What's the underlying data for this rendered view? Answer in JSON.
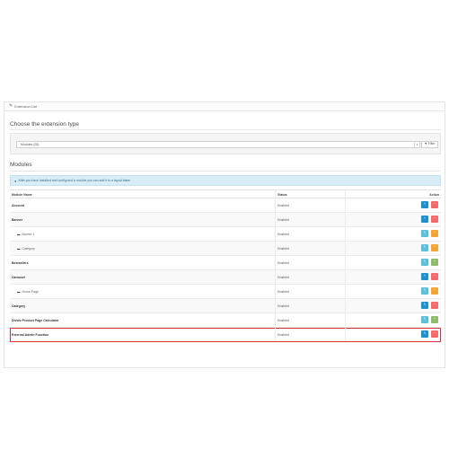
{
  "breadcrumb": {
    "title": "Extension List"
  },
  "extension_type": {
    "heading": "Choose the extension type",
    "select_value": "Modules (28)",
    "filter_label": "Filter"
  },
  "modules": {
    "heading": "Modules",
    "alert_text": "After you have installed and configured a module you can add it to a layout",
    "alert_bold": "here",
    "columns": {
      "name": "Module Name",
      "status": "Status",
      "action": "Action"
    },
    "rows": [
      {
        "name": "Account",
        "status": "Enabled"
      },
      {
        "name": "Banner",
        "status": "Enabled"
      },
      {
        "name": "Banner 1",
        "status": "Enabled"
      },
      {
        "name": "Category",
        "status": "Enabled"
      },
      {
        "name": "Bestsellers",
        "status": "Enabled"
      },
      {
        "name": "Carousel",
        "status": "Enabled"
      },
      {
        "name": "Home Page",
        "status": "Enabled"
      },
      {
        "name": "Category",
        "status": "Enabled"
      },
      {
        "name": "Divido Product Page Calculator",
        "status": "Enabled"
      },
      {
        "name": "External Admin Function",
        "status": "Enabled"
      }
    ]
  },
  "icons": {
    "puzzle": "puzzle-icon",
    "folder": "folder-icon",
    "info": "info-icon",
    "pencil": "pencil-icon",
    "plus": "plus-icon",
    "minus": "minus-icon",
    "filter": "filter-icon"
  },
  "colors": {
    "primary": "#1e91cf",
    "info": "#5bc0de",
    "danger": "#f56b6b",
    "success": "#8fbb6c",
    "warning": "#f3a638",
    "highlight": "#d9303b"
  }
}
